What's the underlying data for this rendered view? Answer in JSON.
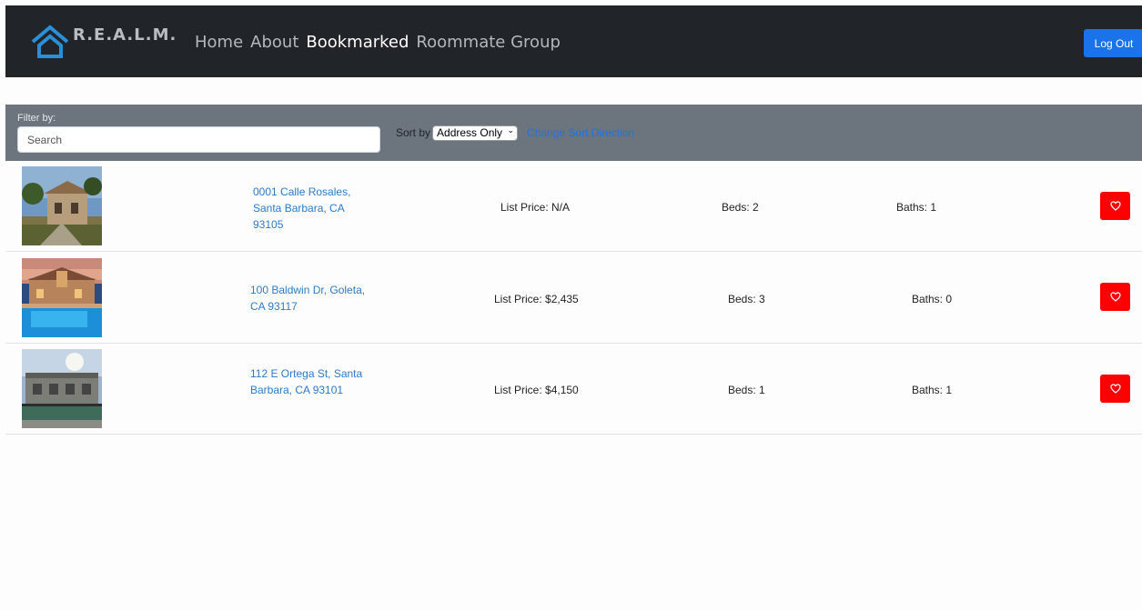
{
  "navbar": {
    "brand": "R.E.A.L.M.",
    "links": [
      {
        "label": "Home",
        "active": false
      },
      {
        "label": "About",
        "active": false
      },
      {
        "label": "Bookmarked",
        "active": true
      },
      {
        "label": "Roommate Group",
        "active": false
      }
    ],
    "logout_label": "Log Out"
  },
  "filter": {
    "label": "Filter by:",
    "search_placeholder": "Search",
    "sort_label": "Sort by",
    "sort_value": "Address Only",
    "sort_direction_label": "Change Sort Direction"
  },
  "listings": [
    {
      "address": "0001 Calle Rosales, Santa Barbara, CA 93105",
      "price": "List Price: N/A",
      "beds": "Beds: 2",
      "baths": "Baths: 1",
      "bookmark_icon": "heart-icon"
    },
    {
      "address": "100 Baldwin Dr, Goleta, CA 93117",
      "price": "List Price: $2,435",
      "beds": "Beds: 3",
      "baths": "Baths: 0",
      "bookmark_icon": "heart-icon"
    },
    {
      "address": "112 E Ortega St, Santa Barbara, CA 93101",
      "price": "List Price: $4,150",
      "beds": "Beds: 1",
      "baths": "Baths: 1",
      "bookmark_icon": "heart-icon"
    }
  ],
  "colors": {
    "navbar_bg": "#212428",
    "filterbar_bg": "#6c757d",
    "accent_blue": "#1a73ea",
    "bookmark_red": "#ff0000",
    "link_blue": "#2d7ac8"
  }
}
